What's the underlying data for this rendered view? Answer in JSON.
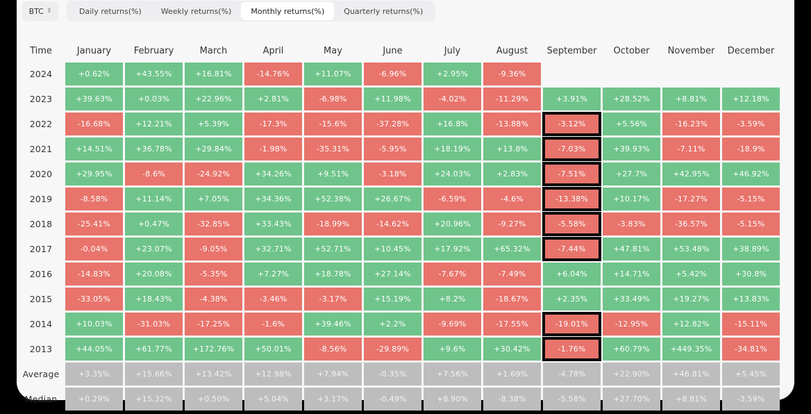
{
  "asset_selector": {
    "value": "BTC",
    "icon": "up-down-chevron-icon"
  },
  "tabs": [
    {
      "label": "Daily returns(%)",
      "active": false
    },
    {
      "label": "Weekly returns(%)",
      "active": false
    },
    {
      "label": "Monthly returns(%)",
      "active": true
    },
    {
      "label": "Quarterly returns(%)",
      "active": false
    }
  ],
  "colors": {
    "positive": "#6fc48b",
    "negative": "#e8746c",
    "stat": "#bdbdbd",
    "highlight_border": "#0a0a0a"
  },
  "table": {
    "time_header": "Time",
    "months": [
      "January",
      "February",
      "March",
      "April",
      "May",
      "June",
      "July",
      "August",
      "September",
      "October",
      "November",
      "December"
    ],
    "highlighted_column": "September",
    "highlighted_years": [
      "2022",
      "2021",
      "2020",
      "2019",
      "2018",
      "2017",
      "2014",
      "2013"
    ],
    "rows": [
      {
        "year": "2024",
        "values": [
          "+0.62%",
          "+43.55%",
          "+16.81%",
          "-14.76%",
          "+11.07%",
          "-6.96%",
          "+2.95%",
          "-9.36%",
          "",
          "",
          "",
          ""
        ]
      },
      {
        "year": "2023",
        "values": [
          "+39.63%",
          "+0.03%",
          "+22.96%",
          "+2.81%",
          "-6.98%",
          "+11.98%",
          "-4.02%",
          "-11.29%",
          "+3.91%",
          "+28.52%",
          "+8.81%",
          "+12.18%"
        ]
      },
      {
        "year": "2022",
        "values": [
          "-16.68%",
          "+12.21%",
          "+5.39%",
          "-17.3%",
          "-15.6%",
          "-37.28%",
          "+16.8%",
          "-13.88%",
          "-3.12%",
          "+5.56%",
          "-16.23%",
          "-3.59%"
        ]
      },
      {
        "year": "2021",
        "values": [
          "+14.51%",
          "+36.78%",
          "+29.84%",
          "-1.98%",
          "-35.31%",
          "-5.95%",
          "+18.19%",
          "+13.8%",
          "-7.03%",
          "+39.93%",
          "-7.11%",
          "-18.9%"
        ]
      },
      {
        "year": "2020",
        "values": [
          "+29.95%",
          "-8.6%",
          "-24.92%",
          "+34.26%",
          "+9.51%",
          "-3.18%",
          "+24.03%",
          "+2.83%",
          "-7.51%",
          "+27.7%",
          "+42.95%",
          "+46.92%"
        ]
      },
      {
        "year": "2019",
        "values": [
          "-8.58%",
          "+11.14%",
          "+7.05%",
          "+34.36%",
          "+52.38%",
          "+26.67%",
          "-6.59%",
          "-4.6%",
          "-13.38%",
          "+10.17%",
          "-17.27%",
          "-5.15%"
        ]
      },
      {
        "year": "2018",
        "values": [
          "-25.41%",
          "+0.47%",
          "-32.85%",
          "+33.43%",
          "-18.99%",
          "-14.62%",
          "+20.96%",
          "-9.27%",
          "-5.58%",
          "-3.83%",
          "-36.57%",
          "-5.15%"
        ]
      },
      {
        "year": "2017",
        "values": [
          "-0.04%",
          "+23.07%",
          "-9.05%",
          "+32.71%",
          "+52.71%",
          "+10.45%",
          "+17.92%",
          "+65.32%",
          "-7.44%",
          "+47.81%",
          "+53.48%",
          "+38.89%"
        ]
      },
      {
        "year": "2016",
        "values": [
          "-14.83%",
          "+20.08%",
          "-5.35%",
          "+7.27%",
          "+18.78%",
          "+27.14%",
          "-7.67%",
          "-7.49%",
          "+6.04%",
          "+14.71%",
          "+5.42%",
          "+30.8%"
        ]
      },
      {
        "year": "2015",
        "values": [
          "-33.05%",
          "+18.43%",
          "-4.38%",
          "-3.46%",
          "-3.17%",
          "+15.19%",
          "+8.2%",
          "-18.67%",
          "+2.35%",
          "+33.49%",
          "+19.27%",
          "+13.83%"
        ]
      },
      {
        "year": "2014",
        "values": [
          "+10.03%",
          "-31.03%",
          "-17.25%",
          "-1.6%",
          "+39.46%",
          "+2.2%",
          "-9.69%",
          "-17.55%",
          "-19.01%",
          "-12.95%",
          "+12.82%",
          "-15.11%"
        ]
      },
      {
        "year": "2013",
        "values": [
          "+44.05%",
          "+61.77%",
          "+172.76%",
          "+50.01%",
          "-8.56%",
          "-29.89%",
          "+9.6%",
          "+30.42%",
          "-1.76%",
          "+60.79%",
          "+449.35%",
          "-34.81%"
        ]
      }
    ],
    "stats": [
      {
        "label": "Average",
        "values": [
          "+3.35%",
          "+15.66%",
          "+13.42%",
          "+12.98%",
          "+7.94%",
          "-0.35%",
          "+7.56%",
          "+1.69%",
          "-4.78%",
          "+22.90%",
          "+46.81%",
          "+5.45%"
        ]
      },
      {
        "label": "Median",
        "values": [
          "+0.29%",
          "+15.32%",
          "+0.50%",
          "+5.04%",
          "+3.17%",
          "-0.49%",
          "+8.90%",
          "-8.38%",
          "-5.58%",
          "+27.70%",
          "+8.81%",
          "-3.59%"
        ]
      }
    ]
  }
}
